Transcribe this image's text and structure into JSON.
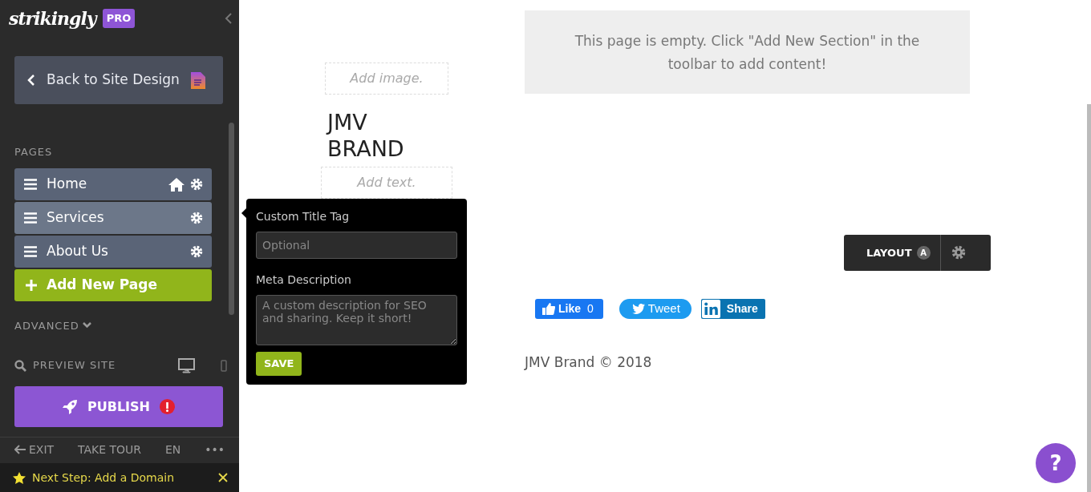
{
  "sidebar": {
    "logo": "strikingly",
    "plan_badge": "PRO",
    "back_button": "Back to Site Design",
    "pages_heading": "PAGES",
    "pages": [
      {
        "label": "Home",
        "home": true,
        "selected": false
      },
      {
        "label": "Services",
        "home": false,
        "selected": true
      },
      {
        "label": "About Us",
        "home": false,
        "selected": false
      }
    ],
    "add_page_button": "Add New Page",
    "advanced_toggle": "ADVANCED",
    "preview_label": "PREVIEW SITE",
    "publish_button": "PUBLISH",
    "exit_link": "EXIT",
    "tour_link": "TAKE TOUR",
    "language": "EN",
    "more_button": "•••",
    "next_step": "Next Step: Add a Domain"
  },
  "popover": {
    "title_label": "Custom Title Tag",
    "title_placeholder": "Optional",
    "description_label": "Meta Description",
    "description_placeholder": "A custom description for SEO and sharing. Keep it short!",
    "save_button": "SAVE"
  },
  "canvas": {
    "image_placeholder": "Add image.",
    "brand_name": "JMV BRAND",
    "text_placeholder": "Add text.",
    "empty_notice": "This page is empty. Click \"Add New Section\" in the toolbar to add content!",
    "layout_button": "LAYOUT",
    "layout_badge": "A",
    "like_button": "Like",
    "like_count": "0",
    "tweet_button": "Tweet",
    "share_button": "Share",
    "footer": "JMV Brand © 2018"
  },
  "help_button": "?"
}
